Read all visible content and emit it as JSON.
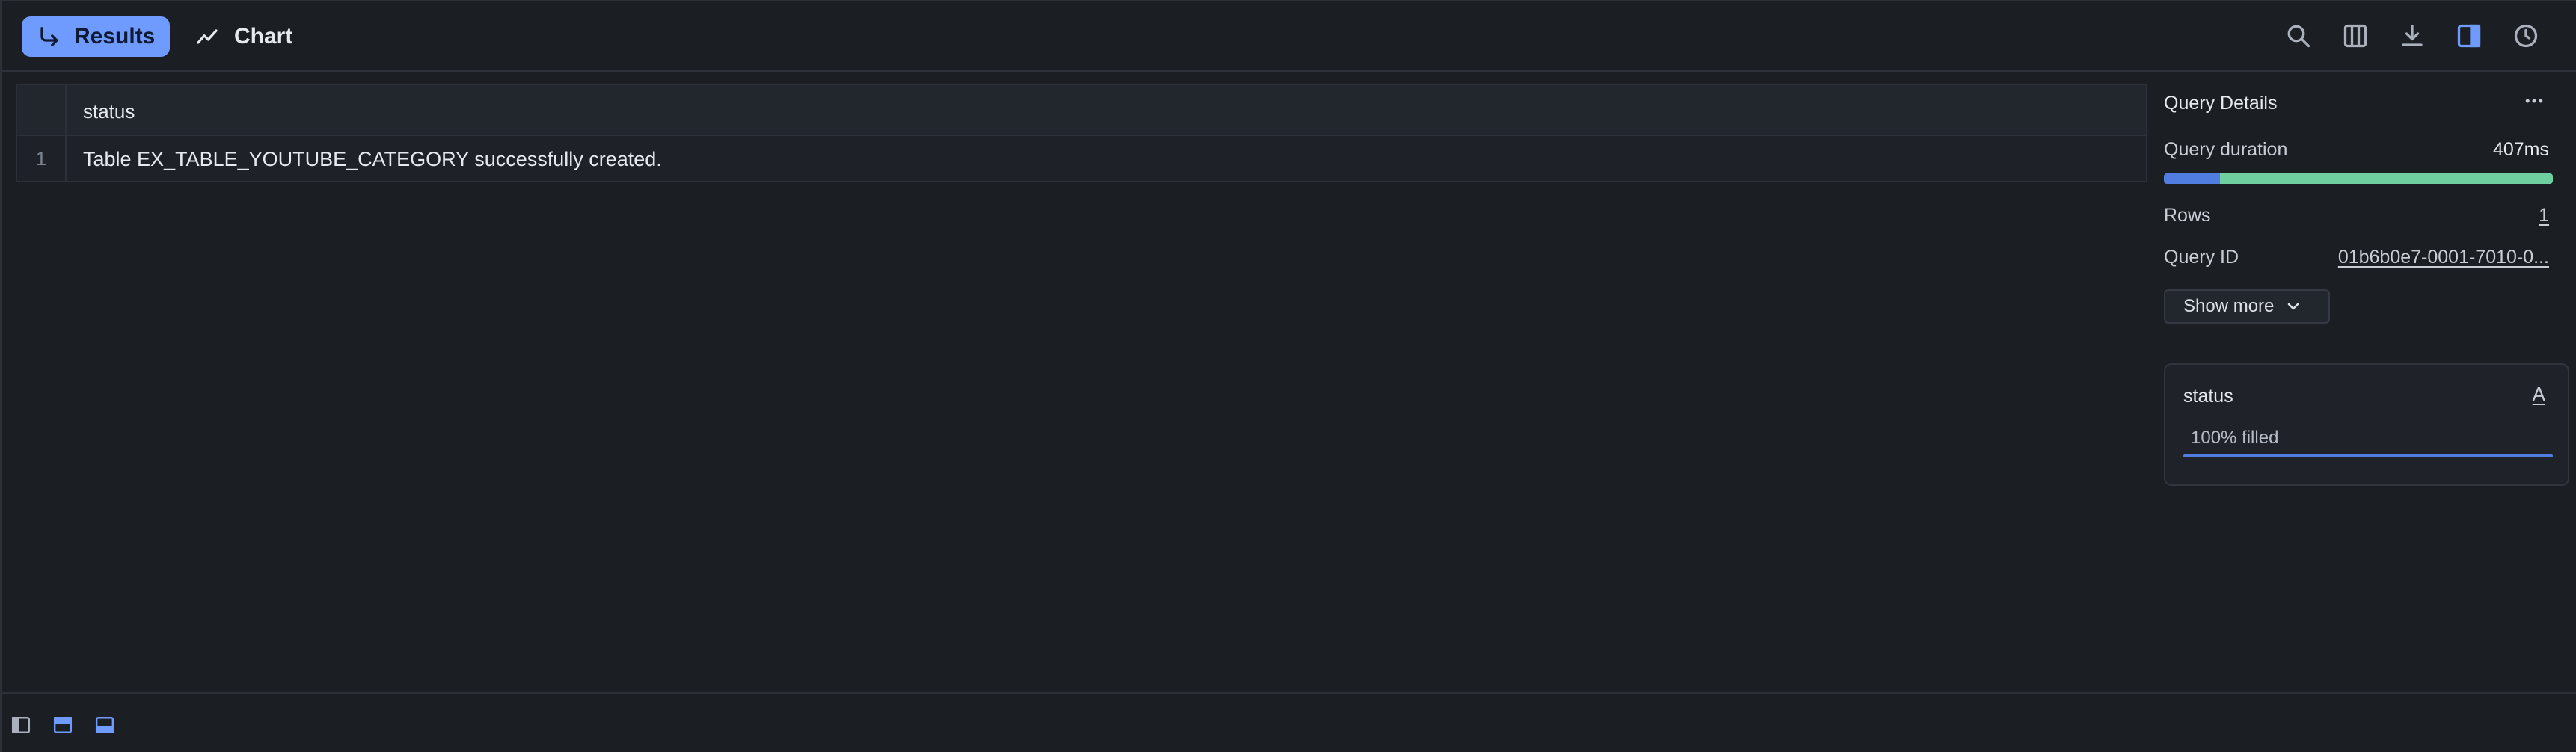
{
  "tabs": {
    "results_label": "Results",
    "chart_label": "Chart"
  },
  "toolbar": {
    "icons": [
      "search-icon",
      "columns-icon",
      "download-icon",
      "sidebar-toggle-icon",
      "history-icon"
    ],
    "accent": "#6f9bff"
  },
  "table": {
    "columns": [
      "status"
    ],
    "rows": [
      {
        "index": "1",
        "status": "Table EX_TABLE_YOUTUBE_CATEGORY successfully created."
      }
    ]
  },
  "query_details": {
    "title": "Query Details",
    "duration_label": "Query duration",
    "duration_value": "407ms",
    "duration_split": {
      "compile_fraction": 0.145,
      "execute_fraction": 0.855,
      "compile_color": "#4f7de0",
      "execute_color": "#6fcf9f"
    },
    "rows_label": "Rows",
    "rows_value": "1",
    "query_id_label": "Query ID",
    "query_id_value": "01b6b0e7-0001-7010-0...",
    "show_more_label": "Show more"
  },
  "column_card": {
    "name": "status",
    "type_glyph": "A",
    "filled_text": "100% filled",
    "filled_fraction": 1.0
  }
}
